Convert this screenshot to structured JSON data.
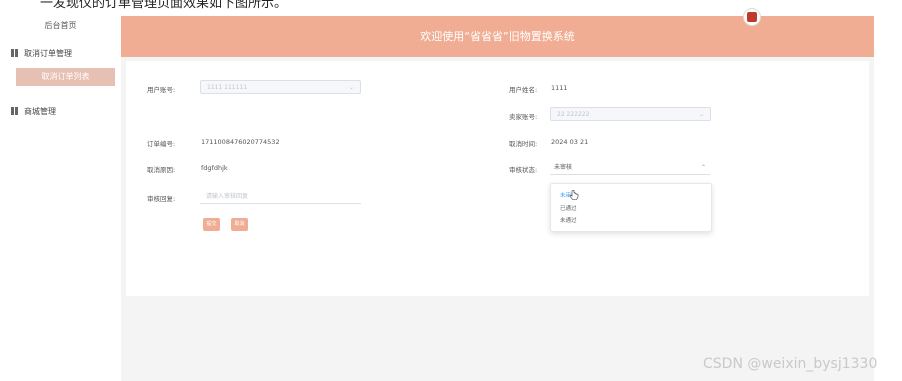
{
  "doc_fragment": "一发现仪的订单管理页面效果如下图所示。",
  "sidebar": {
    "title": "后台首页",
    "items": [
      {
        "label": "取消订单管理",
        "icon": "grid-icon"
      },
      {
        "label": "取消订单列表",
        "active": true
      },
      {
        "label": "商城管理",
        "icon": "grid-icon"
      }
    ]
  },
  "header": {
    "title": "欢迎使用“省省省”旧物置换系统"
  },
  "form": {
    "user_account": {
      "label": "用户账号:",
      "value": "1111 111111"
    },
    "user_name": {
      "label": "用户姓名:",
      "value": "1111"
    },
    "seller_account": {
      "label": "卖家账号:",
      "value": "22 222222"
    },
    "order_no": {
      "label": "订单编号:",
      "value": "1711008476020774532"
    },
    "cancel_time": {
      "label": "取消时间:",
      "value": "2024 03 21"
    },
    "cancel_reason": {
      "label": "取消原因:",
      "value": "fdgfdhjk"
    },
    "review_status": {
      "label": "审核状态:",
      "value": "未审核"
    },
    "review_reply": {
      "label": "审核回复:",
      "placeholder": "请输入审核回复"
    },
    "submit_label": "提交",
    "cancel_label": "取消"
  },
  "dropdown": {
    "options": [
      "未审核",
      "已通过",
      "未通过"
    ],
    "selected": "未审核"
  },
  "watermark": "CSDN @weixin_bysj1330",
  "colors": {
    "accent": "#f0ad93",
    "active_sidebar": "#e6c0b2",
    "selected_option": "#409eff"
  }
}
